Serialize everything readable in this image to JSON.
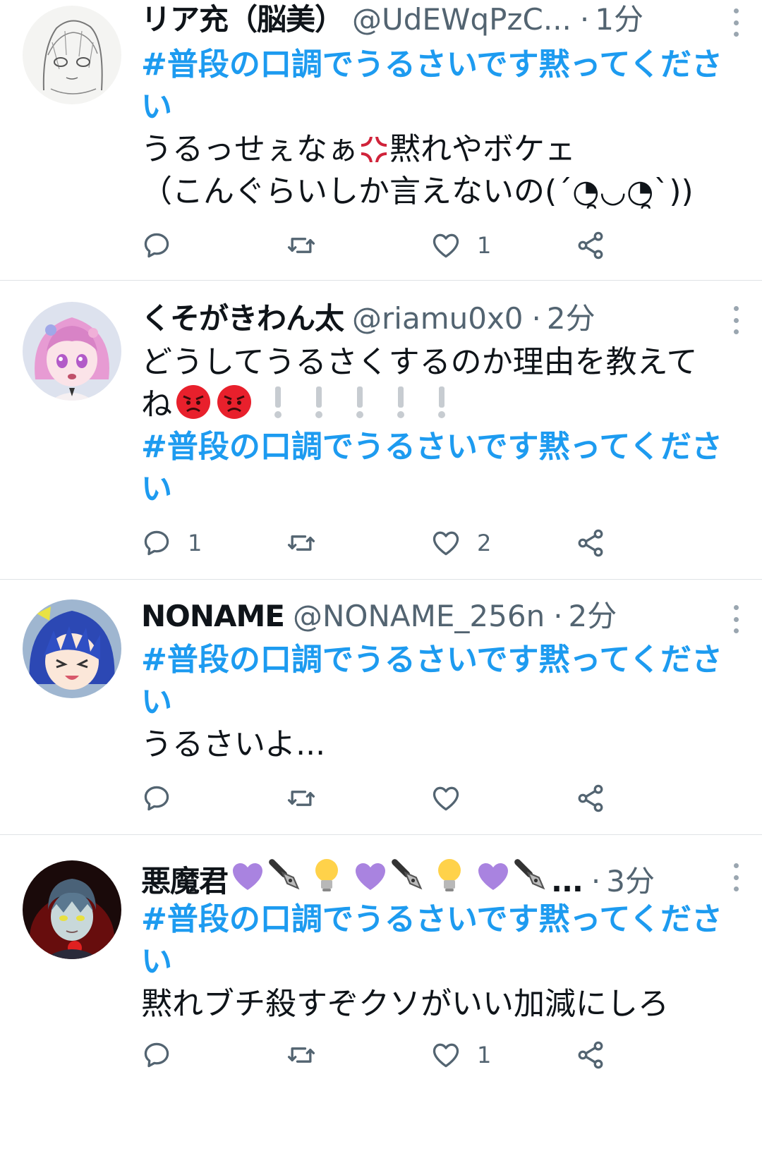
{
  "icons": {
    "reply": "reply-icon",
    "retweet": "retweet-icon",
    "like": "heart-icon",
    "share": "share-icon",
    "more": "more-vertical-icon"
  },
  "colors": {
    "hashtag": "#1d9bf0",
    "secondary": "#536471",
    "divider": "#dfe3e6"
  },
  "tweets": [
    {
      "name": "リア充（脳美）",
      "handle": "@UdEWqPzC...",
      "separator": "·",
      "time": "1分",
      "hashtag": "#普段の口調でうるさいです黙ってください",
      "text_before": "うるっせぇなぁ",
      "text_after": "黙れやボケェ\n（こんぐらいしか言えないの(´◔̯◡◔̯`))",
      "replies": "",
      "retweets": "",
      "likes": "1"
    },
    {
      "name": "くそがきわん太",
      "handle": "@riamu0x0",
      "separator": "·",
      "time": "2分",
      "text": "どうしてうるさくするのか理由を教えてね",
      "hashtag": "#普段の口調でうるさいです黙ってください",
      "replies": "1",
      "retweets": "",
      "likes": "2"
    },
    {
      "name": "NONAME",
      "handle": "@NONAME_256n",
      "separator": "·",
      "time": "2分",
      "hashtag": "#普段の口調でうるさいです黙ってください",
      "text": "うるさいよ...",
      "replies": "",
      "retweets": "",
      "likes": ""
    },
    {
      "name": "悪魔君",
      "name_suffix": "...",
      "separator": "·",
      "time": "3分",
      "hashtag": "#普段の口調でうるさいです黙ってください",
      "text": "黙れブチ殺すぞクソがいい加減にしろ",
      "replies": "",
      "retweets": "",
      "likes": "1"
    }
  ]
}
